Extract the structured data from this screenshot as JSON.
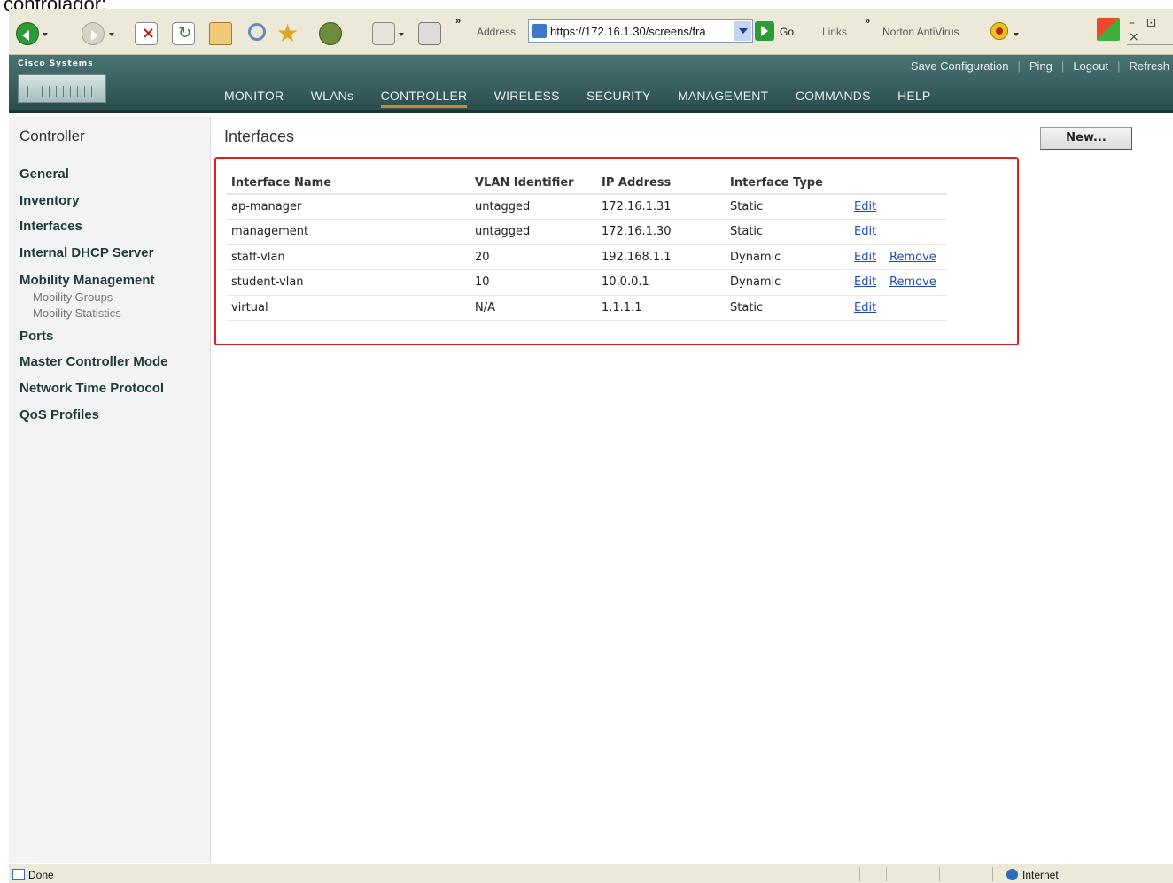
{
  "caption": "controlador:",
  "browser": {
    "address_label": "Address",
    "address_url": "https://172.16.1.30/screens/fra",
    "go_label": "Go",
    "links_label": "Links",
    "norton_label": "Norton AntiVirus",
    "chevron": "»",
    "window_buttons": "– ⊡ ×"
  },
  "header": {
    "brand": "Cisco Systems",
    "top_links": [
      "Save Configuration",
      "Ping",
      "Logout",
      "Refresh"
    ],
    "nav": [
      "MONITOR",
      "WLANs",
      "CONTROLLER",
      "WIRELESS",
      "SECURITY",
      "MANAGEMENT",
      "COMMANDS",
      "HELP"
    ],
    "active_nav": "CONTROLLER"
  },
  "sidebar": {
    "title": "Controller",
    "items": [
      "General",
      "Inventory",
      "Interfaces",
      "Internal DHCP Server",
      "Mobility Management",
      "Ports",
      "Master Controller Mode",
      "Network Time Protocol",
      "QoS Profiles"
    ],
    "mobility_subitems": [
      "Mobility Groups",
      "Mobility Statistics"
    ]
  },
  "main": {
    "title": "Interfaces",
    "new_button": "New...",
    "columns": [
      "Interface Name",
      "VLAN Identifier",
      "IP Address",
      "Interface Type"
    ],
    "rows": [
      {
        "name": "ap-manager",
        "vlan": "untagged",
        "ip": "172.16.1.31",
        "type": "Static",
        "edit": "Edit",
        "remove": ""
      },
      {
        "name": "management",
        "vlan": "untagged",
        "ip": "172.16.1.30",
        "type": "Static",
        "edit": "Edit",
        "remove": ""
      },
      {
        "name": "staff-vlan",
        "vlan": "20",
        "ip": "192.168.1.1",
        "type": "Dynamic",
        "edit": "Edit",
        "remove": "Remove"
      },
      {
        "name": "student-vlan",
        "vlan": "10",
        "ip": "10.0.0.1",
        "type": "Dynamic",
        "edit": "Edit",
        "remove": "Remove"
      },
      {
        "name": "virtual",
        "vlan": "N/A",
        "ip": "1.1.1.1",
        "type": "Static",
        "edit": "Edit",
        "remove": ""
      }
    ]
  },
  "status_bar": {
    "text": "Done",
    "zone": "Internet"
  },
  "colors": {
    "header_bg": "#2b4e4e",
    "active_tab": "#c88a2a",
    "highlight": "#e02020",
    "link": "#2348b8"
  },
  "icons": [
    "back-icon",
    "forward-icon",
    "stop-icon",
    "refresh-icon",
    "home-icon",
    "search-icon",
    "favorites-icon",
    "history-icon",
    "mail-icon",
    "print-icon",
    "page-icon",
    "go-icon",
    "norton-icon",
    "windows-logo-icon",
    "internet-zone-icon"
  ]
}
